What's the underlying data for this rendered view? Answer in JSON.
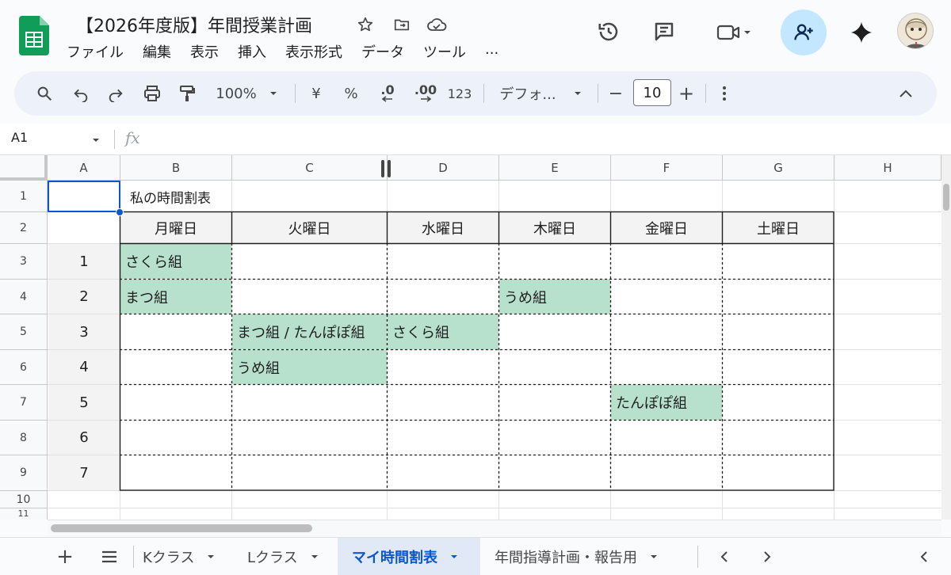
{
  "doc": {
    "title": "【2026年度版】年間授業計画",
    "menu": [
      "ファイル",
      "編集",
      "表示",
      "挿入",
      "表示形式",
      "データ",
      "ツール",
      "..."
    ]
  },
  "toolbar": {
    "zoom": "100%",
    "currency": "¥",
    "percent": "%",
    "dec_decrease": ".0",
    "dec_increase": ".00",
    "number_format": "123",
    "font": "デフォ...",
    "font_size": "10",
    "minus": "−",
    "plus": "+"
  },
  "formula_bar": {
    "cell_ref": "A1",
    "fx": "fx"
  },
  "grid": {
    "columns": [
      "A",
      "B",
      "C",
      "D",
      "E",
      "F",
      "G",
      "H"
    ],
    "rows": [
      "1",
      "2",
      "3",
      "4",
      "5",
      "6",
      "7",
      "8",
      "9",
      "10",
      "11"
    ],
    "title": "私の時間割表",
    "weekdays": [
      "月曜日",
      "火曜日",
      "水曜日",
      "木曜日",
      "金曜日",
      "土曜日"
    ],
    "periods": [
      "1",
      "2",
      "3",
      "4",
      "5",
      "6",
      "7"
    ],
    "entries": {
      "b3": "さくら組",
      "b4": "まつ組",
      "e4": "うめ組",
      "c5": "まつ組 / たんぽぽ組",
      "d5": "さくら組",
      "c6": "うめ組",
      "f7": "たんぽぽ組"
    }
  },
  "sheets": {
    "tabs": [
      "Kクラス",
      "Lクラス",
      "マイ時間割表",
      "年間指導計画・報告用"
    ],
    "active": "マイ時間割表"
  },
  "colors": {
    "accent": "#0b57d0",
    "highlight": "#b7e1cd",
    "share_bg": "#c2e7ff",
    "sheets_green": "#0f9d58"
  }
}
